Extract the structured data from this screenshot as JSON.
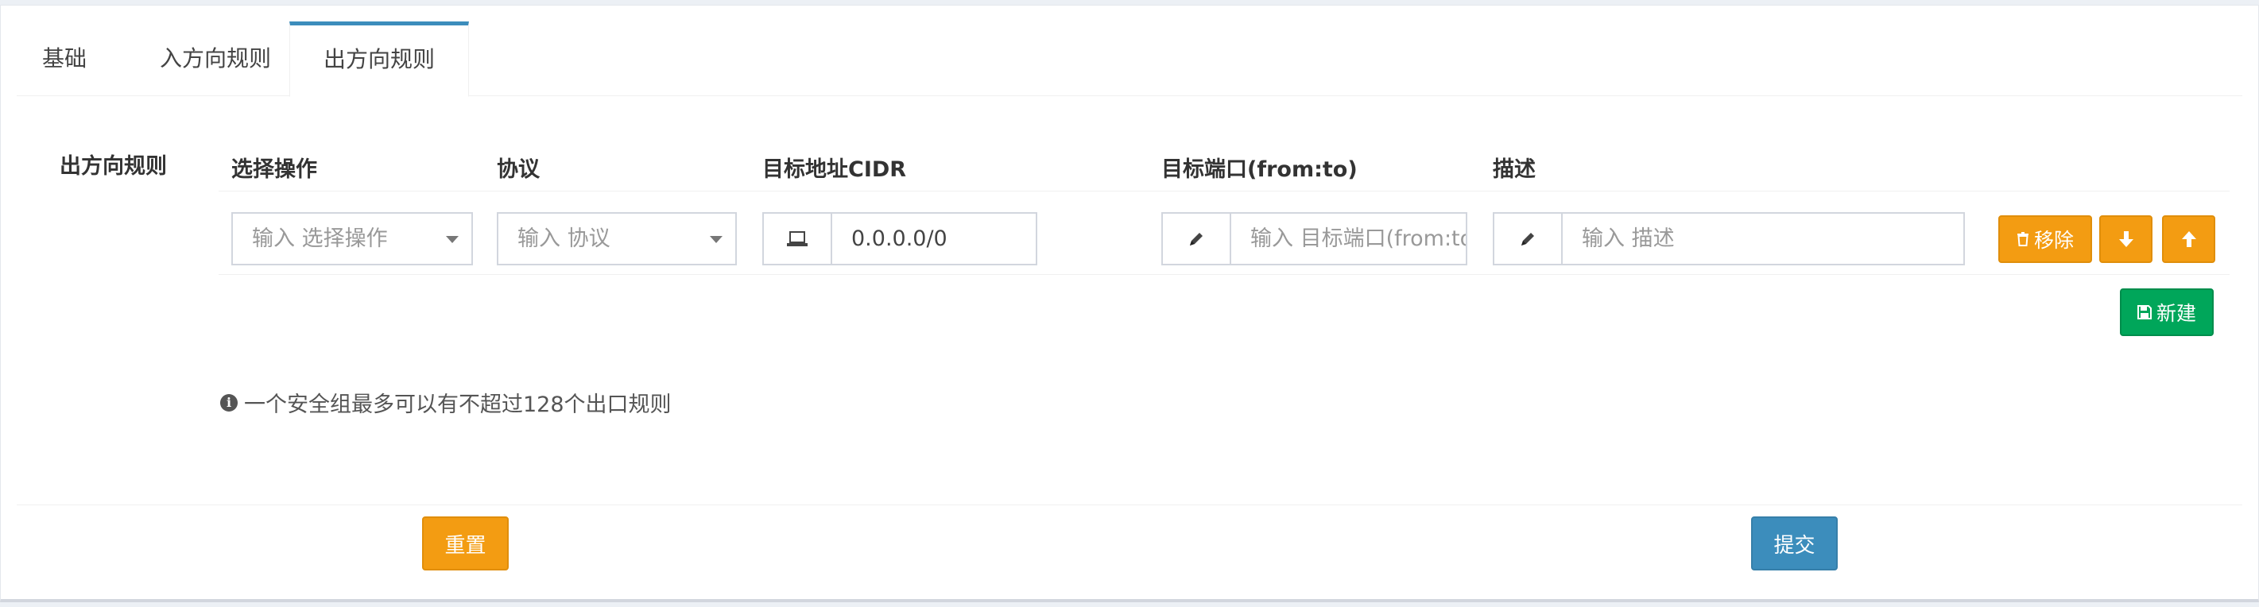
{
  "tabs": [
    {
      "label": "基础"
    },
    {
      "label": "入方向规则"
    },
    {
      "label": "出方向规则"
    }
  ],
  "section": {
    "label": "出方向规则"
  },
  "columns": {
    "action": "选择操作",
    "protocol": "协议",
    "cidr": "目标地址CIDR",
    "port": "目标端口(from:to)",
    "desc": "描述"
  },
  "row": {
    "action_placeholder": "输入 选择操作",
    "protocol_placeholder": "输入 协议",
    "cidr_value": "0.0.0.0/0",
    "port_placeholder": "输入 目标端口(from:to)",
    "desc_placeholder": "输入 描述",
    "remove_label": "移除"
  },
  "new_button": {
    "label": "新建"
  },
  "note": {
    "text": "一个安全组最多可以有不超过128个出口规则"
  },
  "footer": {
    "reset_label": "重置",
    "submit_label": "提交"
  },
  "colors": {
    "accent": "#3c8dbc",
    "warning": "#f39c12",
    "success": "#00a65a"
  }
}
